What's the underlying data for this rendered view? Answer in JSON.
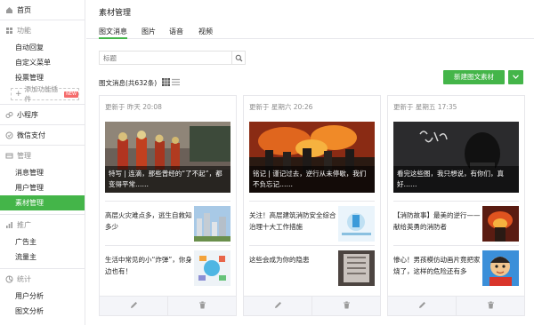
{
  "sidebar": {
    "home": {
      "label": "首页",
      "icon": "home-icon"
    },
    "groups": [
      {
        "label": "功能",
        "icon": "function-icon",
        "items": [
          "自动回复",
          "自定义菜单",
          "投票管理"
        ],
        "plugin_label": "添加功能插件",
        "plugin_badge": "NEW"
      },
      {
        "label": "小程序",
        "icon": "mini-program-icon",
        "items": []
      },
      {
        "label": "微信支付",
        "icon": "wechat-pay-icon",
        "items": []
      },
      {
        "label": "管理",
        "icon": "manage-icon",
        "items": [
          "消息管理",
          "用户管理",
          "素材管理"
        ],
        "active": "素材管理"
      },
      {
        "label": "推广",
        "icon": "promote-icon",
        "items": [
          "广告主",
          "流量主"
        ]
      },
      {
        "label": "统计",
        "icon": "stats-icon",
        "items": [
          "用户分析",
          "图文分析"
        ]
      }
    ]
  },
  "header": {
    "title": "素材管理"
  },
  "tabs": [
    "图文消息",
    "图片",
    "语音",
    "视频"
  ],
  "search": {
    "placeholder": "标题"
  },
  "count_label": "图文消息(共632条)",
  "new_button": "新建图文素材",
  "colors": {
    "accent": "#44b549",
    "border": "#e7e7eb",
    "muted": "#8d8d8d"
  },
  "cards": [
    {
      "time": "更新于 昨天 20:08",
      "cover_title": "特写 | 连滴，那些曾经的“了不起”，都变得平常……",
      "subs": [
        {
          "text": "高层火灾难点多，逃生自救知多少"
        },
        {
          "text": "生活中常见的小“炸弹”，你身边也有！"
        }
      ]
    },
    {
      "time": "更新于 星期六 20:26",
      "cover_title": "铭记 | 谨记过去，逆行从未停歇，我们不负忘记……",
      "subs": [
        {
          "text": "关注！高层建筑消防安全综合治理十大工作措施"
        },
        {
          "text": "这些会成为你的隐患"
        }
      ]
    },
    {
      "time": "更新于 星期五 17:35",
      "cover_title": "看完这些图，我只想说，有你们，真好……",
      "subs": [
        {
          "text": "【消防故事】最美的逆行——献给英勇的消防者"
        },
        {
          "text": "惨心！男孩模仿动画片竟把家烧了，这样的危险还有多"
        }
      ]
    }
  ]
}
